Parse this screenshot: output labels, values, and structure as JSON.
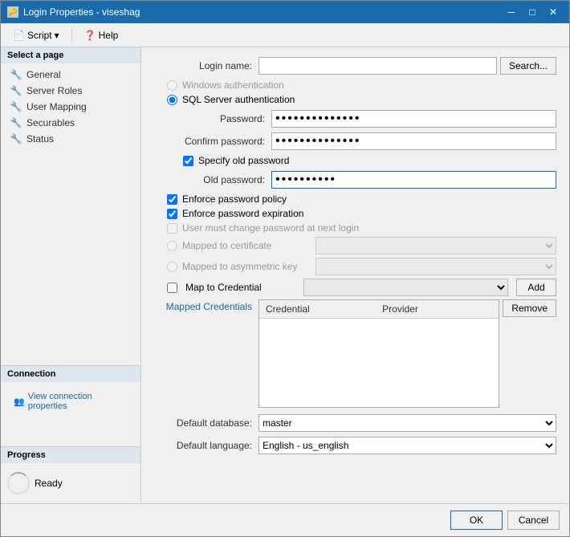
{
  "window": {
    "title": "Login Properties - viseshag",
    "title_icon": "🔑"
  },
  "title_controls": {
    "minimize": "─",
    "maximize": "□",
    "close": "✕"
  },
  "toolbar": {
    "script_label": "Script",
    "help_label": "Help"
  },
  "sidebar": {
    "select_page_header": "Select a page",
    "items": [
      {
        "label": "General",
        "icon": "🔧"
      },
      {
        "label": "Server Roles",
        "icon": "🔧"
      },
      {
        "label": "User Mapping",
        "icon": "🔧"
      },
      {
        "label": "Securables",
        "icon": "🔧"
      },
      {
        "label": "Status",
        "icon": "🔧"
      }
    ],
    "connection_header": "Connection",
    "view_connection_label": "View connection properties",
    "progress_header": "Progress",
    "progress_status": "Ready"
  },
  "form": {
    "login_name_label": "Login name:",
    "login_name_value": "",
    "search_btn": "Search...",
    "auth": {
      "windows_label": "Windows authentication",
      "sql_label": "SQL Server authentication"
    },
    "password_label": "Password:",
    "password_value": "••••••••••••••",
    "confirm_password_label": "Confirm password:",
    "confirm_password_value": "••••••••••••••",
    "specify_old_password_label": "Specify old password",
    "old_password_label": "Old password:",
    "old_password_value": "••••••••••",
    "enforce_policy_label": "Enforce password policy",
    "enforce_expiration_label": "Enforce password expiration",
    "user_must_change_label": "User must change password at next login",
    "mapped_to_cert_label": "Mapped to certificate",
    "mapped_to_asym_label": "Mapped to asymmetric key",
    "map_to_credential_label": "Map to Credential",
    "add_btn": "Add",
    "mapped_credentials_label": "Mapped Credentials",
    "credential_col": "Credential",
    "provider_col": "Provider",
    "remove_btn": "Remove",
    "default_database_label": "Default database:",
    "default_database_value": "master",
    "default_language_label": "Default language:",
    "default_language_value": "English - us_english"
  },
  "footer": {
    "ok_label": "OK",
    "cancel_label": "Cancel"
  },
  "search_detection": {
    "text": "Search ."
  }
}
